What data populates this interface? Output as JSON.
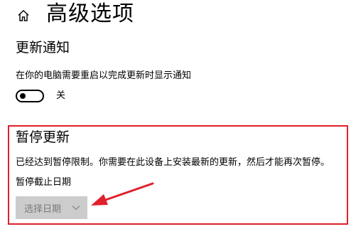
{
  "header": {
    "home_icon": "home-icon",
    "title": "高级选项"
  },
  "notifications": {
    "section_title": "更新通知",
    "description": "在你的电脑需要重启以完成更新时显示通知",
    "toggle_state": "off",
    "toggle_label": "关"
  },
  "pause_updates": {
    "section_title": "暂停更新",
    "message": "已经达到暂停限制。你需要在此设备上安装最新的更新，然后才能再次暂停。",
    "deadline_label": "暂停截止日期",
    "date_select_placeholder": "选择日期",
    "date_select_icon": "chevron-down-icon",
    "disabled": true
  },
  "annotation": {
    "highlight_color": "#e0202a",
    "arrow_icon": "red-arrow-icon"
  }
}
